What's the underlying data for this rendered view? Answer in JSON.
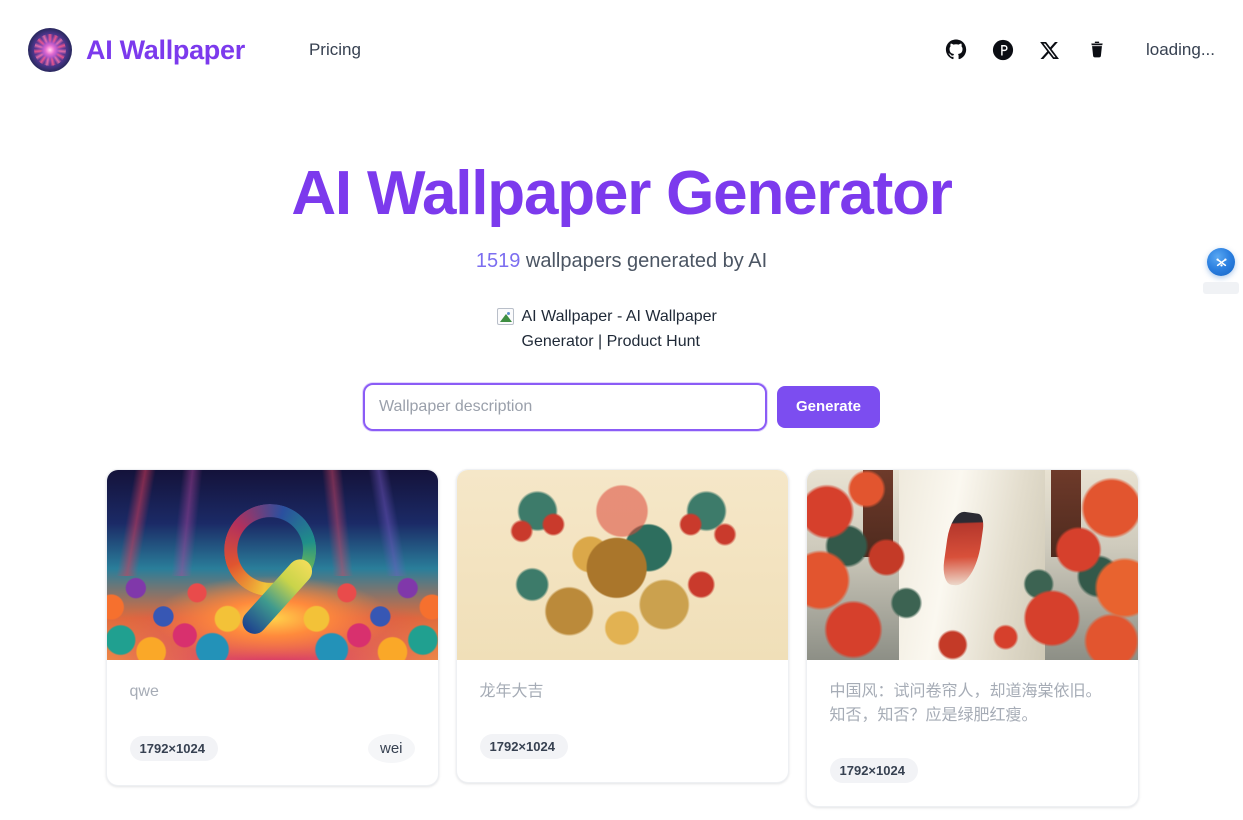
{
  "header": {
    "brand_name": "AI Wallpaper",
    "logo_icon": "ai-wallpaper-logo",
    "nav": [
      {
        "label": "Pricing",
        "name": "pricing"
      }
    ],
    "social": [
      {
        "icon": "github-icon",
        "name": "github"
      },
      {
        "icon": "product-hunt-icon",
        "name": "product-hunt"
      },
      {
        "icon": "x-twitter-icon",
        "name": "x-twitter"
      },
      {
        "icon": "buy-me-a-coffee-icon",
        "name": "buy-me-a-coffee"
      }
    ],
    "status_text": "loading..."
  },
  "hero": {
    "title": "AI Wallpaper Generator",
    "count": "1519",
    "subtitle_suffix": " wallpapers generated by AI",
    "badge_alt": "AI Wallpaper - AI Wallpaper Generator | Product Hunt",
    "badge_icon": "broken-image-icon"
  },
  "search": {
    "value": "",
    "placeholder": "Wallpaper description",
    "button_label": "Generate"
  },
  "float_widget": {
    "icon": "analytics-widget-icon"
  },
  "cards": [
    {
      "title": "qwe",
      "size": "1792×1024",
      "author": "wei",
      "art": "art-1"
    },
    {
      "title": "龙年大吉",
      "size": "1792×1024",
      "author": "",
      "art": "art-2"
    },
    {
      "title": "中国风：试问卷帘人，却道海棠依旧。知否，知否？应是绿肥红瘦。",
      "size": "1792×1024",
      "author": "",
      "art": "art-3"
    }
  ],
  "colors": {
    "brand_purple": "#7c3aed",
    "accent_purple": "#8b5cf6",
    "button_purple": "#7c4df0",
    "muted_text": "#a6acb6",
    "widget_blue": "#1464c4"
  }
}
